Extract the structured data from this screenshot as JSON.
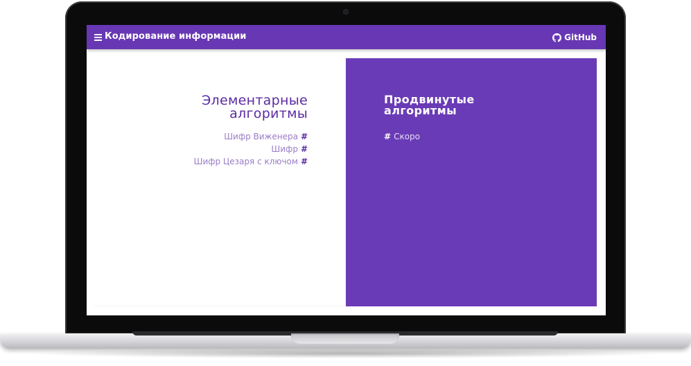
{
  "header": {
    "title": "Кодирование информации",
    "github_label": "GitHub",
    "menu_icon": "hamburger-menu-icon",
    "github_icon": "github-octocat-icon",
    "color": "#6737b4"
  },
  "left_section": {
    "title_line1": "Элементарные",
    "title_line2": "алгоритмы",
    "items": [
      {
        "label": "Шифр Виженера",
        "marker": "#"
      },
      {
        "label": "Шифр",
        "marker": "#"
      },
      {
        "label": "Шифр Цезаря с ключом",
        "marker": "#"
      }
    ],
    "accent": "#5b2aa3"
  },
  "right_section": {
    "title_line1": "Продвинутые",
    "title_line2": "алгоритмы",
    "items": [
      {
        "label": "Скоро",
        "marker": "#"
      }
    ],
    "background": "#6a3bb6"
  }
}
